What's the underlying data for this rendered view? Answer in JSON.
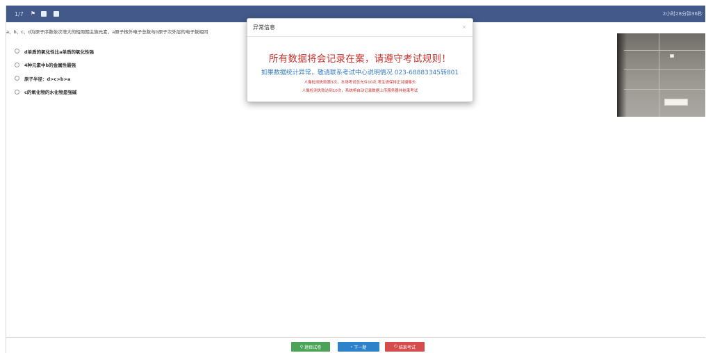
{
  "header": {
    "counter": "1/7",
    "timer": "2小时28分钟36秒",
    "icons": [
      "flag-icon",
      "square-icon",
      "square-icon"
    ]
  },
  "question": {
    "text": "a、b、c、d为原子序数依次增大的短周期主族元素，a原子核外电子总数与b原子次外层的电子数相同",
    "options": [
      "d单质的氧化性比a单质的氧化性强",
      "4种元素中b的金属性最强",
      "原子半径：d>c>b>a",
      "c的氧化物的水化物是强碱"
    ]
  },
  "footer": {
    "buttons": [
      {
        "label": "题目试卷",
        "icon": "search-icon",
        "color": "#4aa356"
      },
      {
        "label": "下一题",
        "icon": "chevron-right-icon",
        "color": "#2e82c9"
      },
      {
        "label": "结束考试",
        "icon": "power-icon",
        "color": "#d54c4c"
      }
    ]
  },
  "modal": {
    "title": "异常信息",
    "close": "×",
    "headline": "所有数据将会记录在案，请遵守考试规则！",
    "contact": "如果数据统计异常，敬请联系考试中心说明情况 023-68883345转801",
    "line1": "人像检测失败第3次，本场考试总允许10次,考生请保持正对摄像头",
    "line2": "人像检测失败达到10次，系统将自动记录数据上传服务器并结束考试"
  },
  "colors": {
    "topbar": "#43598a",
    "alert_red": "#c9302c",
    "info_blue": "#3b7fc4"
  }
}
